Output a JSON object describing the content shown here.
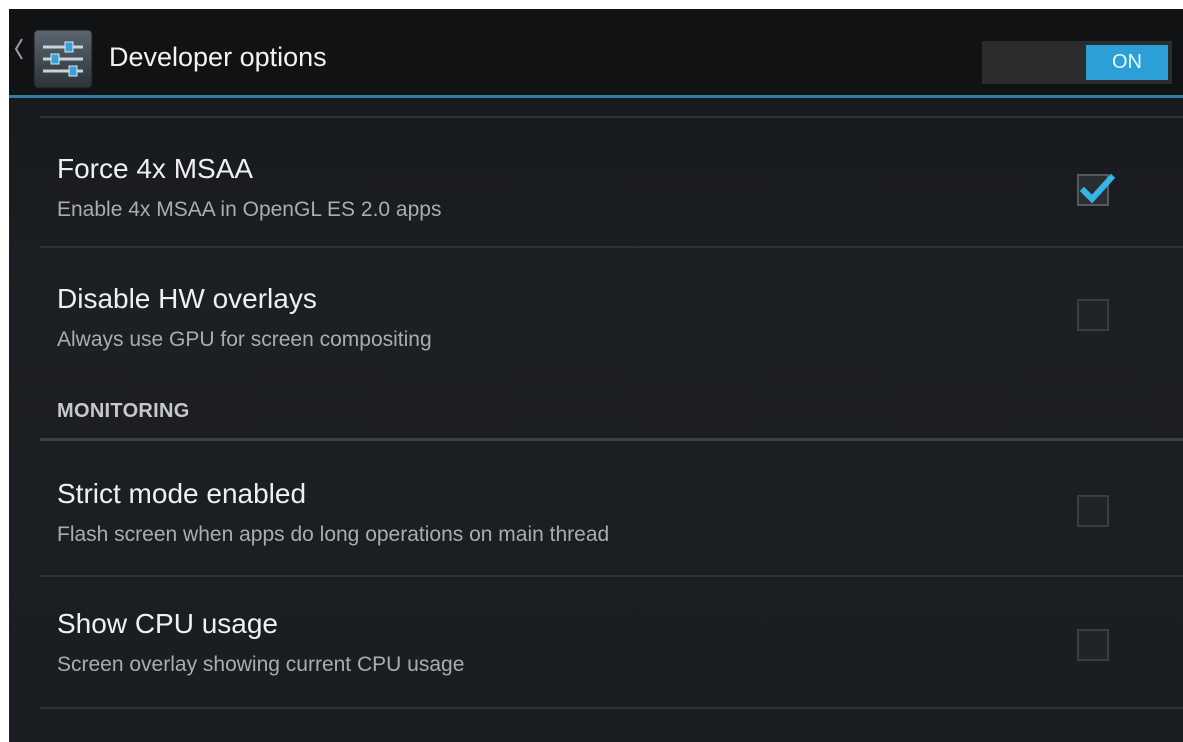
{
  "action_bar": {
    "title": "Developer options",
    "master_switch": {
      "label": "ON",
      "state": "on"
    },
    "icon": "developer-settings-icon",
    "up_icon": "chevron-left-icon",
    "accent_color": "#2b9fd6"
  },
  "preferences": [
    {
      "title": "Force 4x MSAA",
      "summary": "Enable 4x MSAA in OpenGL ES 2.0 apps",
      "checked": true
    },
    {
      "title": "Disable HW overlays",
      "summary": "Always use GPU for screen compositing",
      "checked": false
    }
  ],
  "monitoring": {
    "category_label": "MONITORING",
    "preferences": [
      {
        "title": "Strict mode enabled",
        "summary": "Flash screen when apps do long operations on main thread",
        "checked": false
      },
      {
        "title": "Show CPU usage",
        "summary": "Screen overlay showing current CPU usage",
        "checked": false
      }
    ]
  }
}
